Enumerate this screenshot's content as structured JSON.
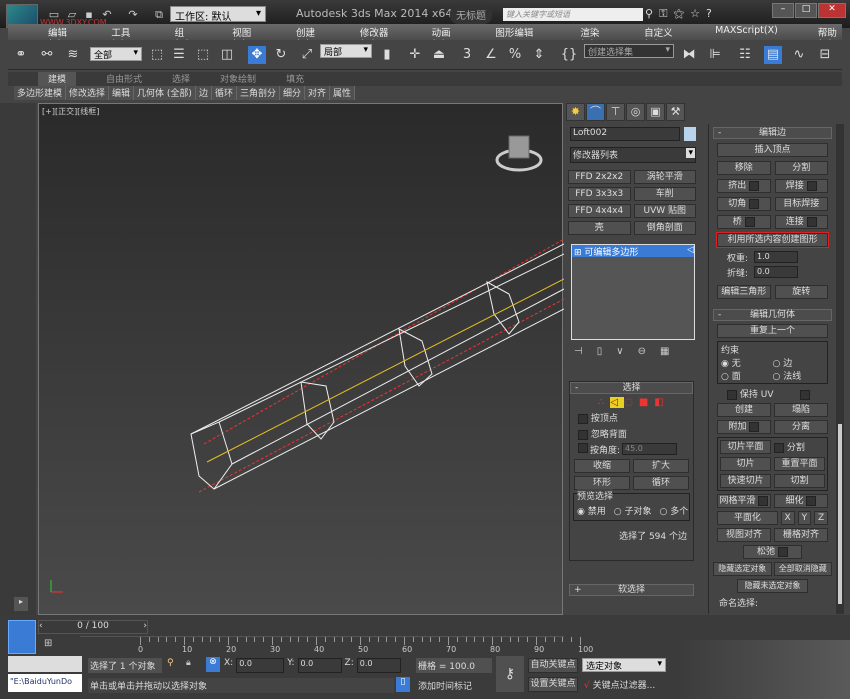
{
  "title_bar": {
    "workspace": "工作区: 默认",
    "app_title": "Autodesk 3ds Max  2014 x64",
    "doc_title": "无标题",
    "search_placeholder": "键入关键字或短语",
    "watermark": "WWW.3DXY.COM"
  },
  "menu": [
    "编辑(E)",
    "工具(T)",
    "组(G)",
    "视图(V)",
    "创建(C)",
    "修改器(M)",
    "动画(A)",
    "图形编辑器(D)",
    "渲染(R)",
    "自定义(U)",
    "MAXScript(X)",
    "帮助(H)"
  ],
  "toolbar": {
    "filter": "全部",
    "coord": "局部",
    "selection_set": "创建选择集",
    "snap_label": "3"
  },
  "ribbon": {
    "tabs": [
      "建模",
      "自由形式",
      "选择",
      "对象绘制",
      "填充"
    ],
    "subtabs": [
      "多边形建模",
      "修改选择",
      "编辑",
      "几何体 (全部)",
      "边",
      "循环",
      "三角剖分",
      "细分",
      "对齐",
      "属性"
    ]
  },
  "viewport": {
    "label": "[+][正交][线框]"
  },
  "command_panel": {
    "object_name": "Loft002",
    "modifier_list": "修改器列表",
    "modifier_buttons": [
      "FFD 2x2x2",
      "涡轮平滑",
      "FFD 3x3x3",
      "车削",
      "FFD 4x4x4",
      "UVW 贴图",
      "壳",
      "倒角剖面"
    ],
    "stack_item": "可编辑多边形",
    "selection": {
      "title": "选择",
      "by_vertex": "按顶点",
      "ignore_backfacing": "忽略背面",
      "by_angle": "按角度:",
      "angle_value": "45.0",
      "shrink": "收缩",
      "grow": "扩大",
      "ring": "环形",
      "loop": "循环",
      "preview_title": "预览选择",
      "preview_options": [
        "禁用",
        "子对象",
        "多个"
      ],
      "status": "选择了 594 个边"
    },
    "soft_selection": "软选择"
  },
  "edit_edges": {
    "title": "编辑边",
    "insert_vertex": "插入顶点",
    "remove": "移除",
    "split": "分割",
    "extrude": "挤出",
    "weld": "焊接",
    "chamfer": "切角",
    "target_weld": "目标焊接",
    "bridge": "桥",
    "connect": "连接",
    "create_shape": "利用所选内容创建图形",
    "weight_label": "权重:",
    "weight": "1.0",
    "crease_label": "折缝:",
    "crease": "0.0",
    "edit_tri": "编辑三角形",
    "turn": "旋转"
  },
  "edit_geometry": {
    "title": "编辑几何体",
    "repeat_last": "重复上一个",
    "constraints": "约束",
    "constraint_options": [
      "无",
      "边",
      "面",
      "法线"
    ],
    "preserve_uv": "保持 UV",
    "create": "创建",
    "collapse": "塌陷",
    "attach": "附加",
    "detach": "分离",
    "slice_plane": "切片平面",
    "split": "分割",
    "slice": "切片",
    "reset_plane": "重置平面",
    "quickslice": "快速切片",
    "cut": "切割",
    "meshsmooth": "网格平滑",
    "tessellate": "细化",
    "make_planar": "平面化",
    "x": "X",
    "y": "Y",
    "z": "Z",
    "view_align": "视图对齐",
    "grid_align": "栅格对齐",
    "relax": "松弛",
    "hide_selected": "隐藏选定对象",
    "unhide_all": "全部取消隐藏",
    "hide_unselected": "隐藏未选定对象",
    "named_sel": "命名选择:"
  },
  "timeline": {
    "frame": "0 / 100",
    "ticks": [
      "0",
      "10",
      "20",
      "30",
      "40",
      "50",
      "60",
      "70",
      "80",
      "90",
      "100"
    ]
  },
  "status_bar": {
    "maxscript": "\"E:\\BaiduYunDo",
    "selected": "选择了 1 个对象",
    "x_label": "X:",
    "x": "0.0",
    "y_label": "Y:",
    "y": "0.0",
    "z_label": "Z:",
    "z": "0.0",
    "grid": "栅格 = 100.0",
    "prompt": "单击或单击并拖动以选择对象",
    "add_time_tag": "添加时间标记",
    "auto_key": "自动关键点",
    "key_mode": "选定对象",
    "set_key": "设置关键点",
    "key_filters": "关键点过滤器..."
  }
}
